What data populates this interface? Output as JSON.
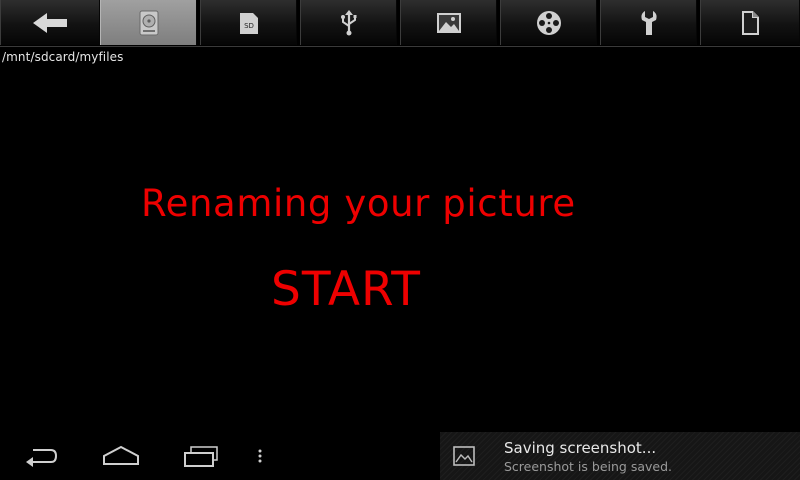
{
  "toolbar": {
    "tabs": [
      {
        "icon": "back-arrow-icon",
        "active": false
      },
      {
        "icon": "hard-drive-icon",
        "active": true
      },
      {
        "icon": "sd-card-icon",
        "active": false
      },
      {
        "icon": "usb-icon",
        "active": false
      },
      {
        "icon": "image-icon",
        "active": false
      },
      {
        "icon": "film-reel-icon",
        "active": false
      },
      {
        "icon": "wrench-icon",
        "active": false
      },
      {
        "icon": "document-icon",
        "active": false
      }
    ],
    "sd_label": "SD"
  },
  "path": "/mnt/sdcard/myfiles",
  "main": {
    "heading": "Renaming your picture",
    "start_label": "START",
    "text_color": "#ee0000"
  },
  "navbar": {
    "buttons": [
      "back-icon",
      "home-icon",
      "recent-apps-icon",
      "menu-icon"
    ]
  },
  "notification": {
    "title": "Saving screenshot...",
    "subtitle": "Screenshot is being saved.",
    "icon": "image-icon"
  }
}
